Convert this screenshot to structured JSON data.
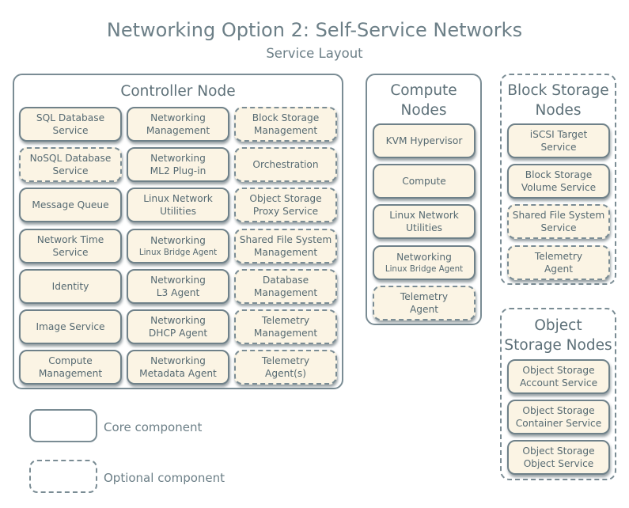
{
  "title": "Networking Option 2: Self-Service Networks",
  "subtitle": "Service Layout",
  "colors": {
    "border": "#7a8c94",
    "service_fill": "#fbf4e4",
    "text": "#5d7078"
  },
  "groups": {
    "controller": {
      "title": "Controller Node",
      "kind": "core",
      "services": [
        {
          "line1": "SQL Database",
          "line2": "Service",
          "kind": "core"
        },
        {
          "line1": "Networking",
          "line2": "Management",
          "kind": "core"
        },
        {
          "line1": "Block Storage",
          "line2": "Management",
          "kind": "optional"
        },
        {
          "line1": "NoSQL Database",
          "line2": "Service",
          "kind": "optional"
        },
        {
          "line1": "Networking",
          "line2": "ML2 Plug-in",
          "kind": "core"
        },
        {
          "line1": "Orchestration",
          "line2": "",
          "kind": "optional"
        },
        {
          "line1": "Message Queue",
          "line2": "",
          "kind": "core"
        },
        {
          "line1": "Linux Network",
          "line2": "Utilities",
          "kind": "core"
        },
        {
          "line1": "Object Storage",
          "line2": "Proxy Service",
          "kind": "optional"
        },
        {
          "line1": "Network Time",
          "line2": "Service",
          "kind": "core"
        },
        {
          "line1": "Networking",
          "line2": "Linux Bridge Agent",
          "kind": "core"
        },
        {
          "line1": "Shared File System",
          "line2": "Management",
          "kind": "optional"
        },
        {
          "line1": "Identity",
          "line2": "",
          "kind": "core"
        },
        {
          "line1": "Networking",
          "line2": "L3 Agent",
          "kind": "core"
        },
        {
          "line1": "Database",
          "line2": "Management",
          "kind": "optional"
        },
        {
          "line1": "Image Service",
          "line2": "",
          "kind": "core"
        },
        {
          "line1": "Networking",
          "line2": "DHCP Agent",
          "kind": "core"
        },
        {
          "line1": "Telemetry",
          "line2": "Management",
          "kind": "optional"
        },
        {
          "line1": "Compute",
          "line2": "Management",
          "kind": "core"
        },
        {
          "line1": "Networking",
          "line2": "Metadata Agent",
          "kind": "core"
        },
        {
          "line1": "Telemetry",
          "line2": "Agent(s)",
          "kind": "optional"
        }
      ]
    },
    "compute": {
      "title_line1": "Compute",
      "title_line2": "Nodes",
      "kind": "core",
      "services": [
        {
          "line1": "KVM Hypervisor",
          "line2": "",
          "kind": "core"
        },
        {
          "line1": "Compute",
          "line2": "",
          "kind": "core"
        },
        {
          "line1": "Linux Network",
          "line2": "Utilities",
          "kind": "core"
        },
        {
          "line1": "Networking",
          "line2": "Linux Bridge Agent",
          "kind": "core"
        },
        {
          "line1": "Telemetry",
          "line2": "Agent",
          "kind": "optional"
        }
      ]
    },
    "block_storage": {
      "title_line1": "Block Storage",
      "title_line2": "Nodes",
      "kind": "optional",
      "services": [
        {
          "line1": "iSCSI Target",
          "line2": "Service",
          "kind": "core"
        },
        {
          "line1": "Block Storage",
          "line2": "Volume Service",
          "kind": "core"
        },
        {
          "line1": "Shared File System",
          "line2": "Service",
          "kind": "optional"
        },
        {
          "line1": "Telemetry",
          "line2": "Agent",
          "kind": "optional"
        }
      ]
    },
    "object_storage": {
      "title_line1": "Object",
      "title_line2": "Storage Nodes",
      "kind": "optional",
      "services": [
        {
          "line1": "Object Storage",
          "line2": "Account Service",
          "kind": "core"
        },
        {
          "line1": "Object Storage",
          "line2": "Container Service",
          "kind": "core"
        },
        {
          "line1": "Object Storage",
          "line2": "Object Service",
          "kind": "core"
        }
      ]
    }
  },
  "legend": {
    "core_label": "Core component",
    "optional_label": "Optional component"
  }
}
